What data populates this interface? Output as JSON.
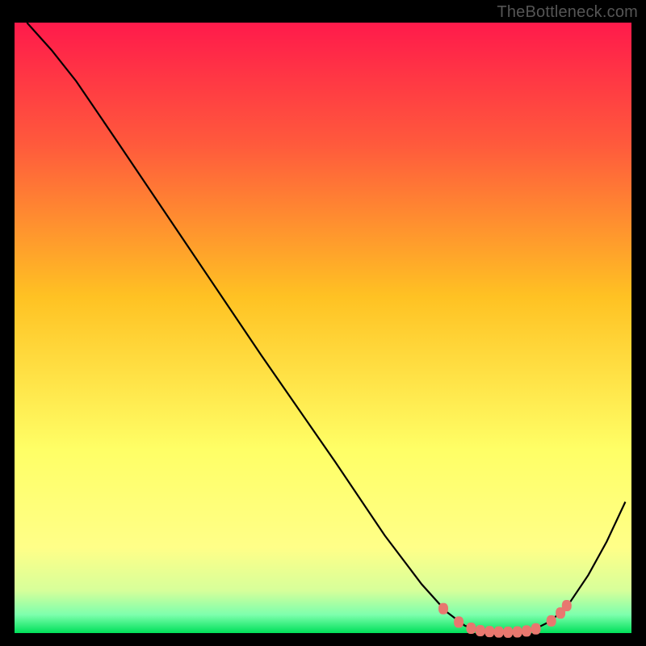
{
  "watermark": "TheBottleneck.com",
  "colors": {
    "frame": "#000000",
    "curve": "#000000",
    "marker_fill": "#e8776f",
    "marker_stroke": "#cf5a55",
    "grad_top": "#ff1a4b",
    "grad_mid1": "#ff7a3c",
    "grad_mid2": "#ffd326",
    "grad_low": "#ffff66",
    "grad_pale": "#eaffb0",
    "grad_green": "#00e05a"
  },
  "chart_data": {
    "type": "line",
    "title": "",
    "xlabel": "",
    "ylabel": "",
    "xrange": [
      0,
      100
    ],
    "yrange": [
      0,
      100
    ],
    "curve": [
      [
        2,
        100
      ],
      [
        6,
        95.5
      ],
      [
        10,
        90.4
      ],
      [
        17,
        80
      ],
      [
        28,
        63.5
      ],
      [
        40,
        45.5
      ],
      [
        52,
        28
      ],
      [
        60,
        16
      ],
      [
        66,
        8
      ],
      [
        70,
        3.5
      ],
      [
        73,
        1.2
      ],
      [
        76,
        0.3
      ],
      [
        80,
        0.1
      ],
      [
        84,
        0.5
      ],
      [
        87,
        2
      ],
      [
        90,
        5
      ],
      [
        93,
        9.5
      ],
      [
        96,
        15
      ],
      [
        99,
        21.5
      ]
    ],
    "markers": [
      [
        69.5,
        4.0
      ],
      [
        72.0,
        1.8
      ],
      [
        74.0,
        0.8
      ],
      [
        75.5,
        0.4
      ],
      [
        77.0,
        0.25
      ],
      [
        78.5,
        0.18
      ],
      [
        80.0,
        0.15
      ],
      [
        81.5,
        0.2
      ],
      [
        83.0,
        0.35
      ],
      [
        84.5,
        0.7
      ],
      [
        87.0,
        2.0
      ],
      [
        88.5,
        3.3
      ],
      [
        89.5,
        4.5
      ]
    ]
  }
}
